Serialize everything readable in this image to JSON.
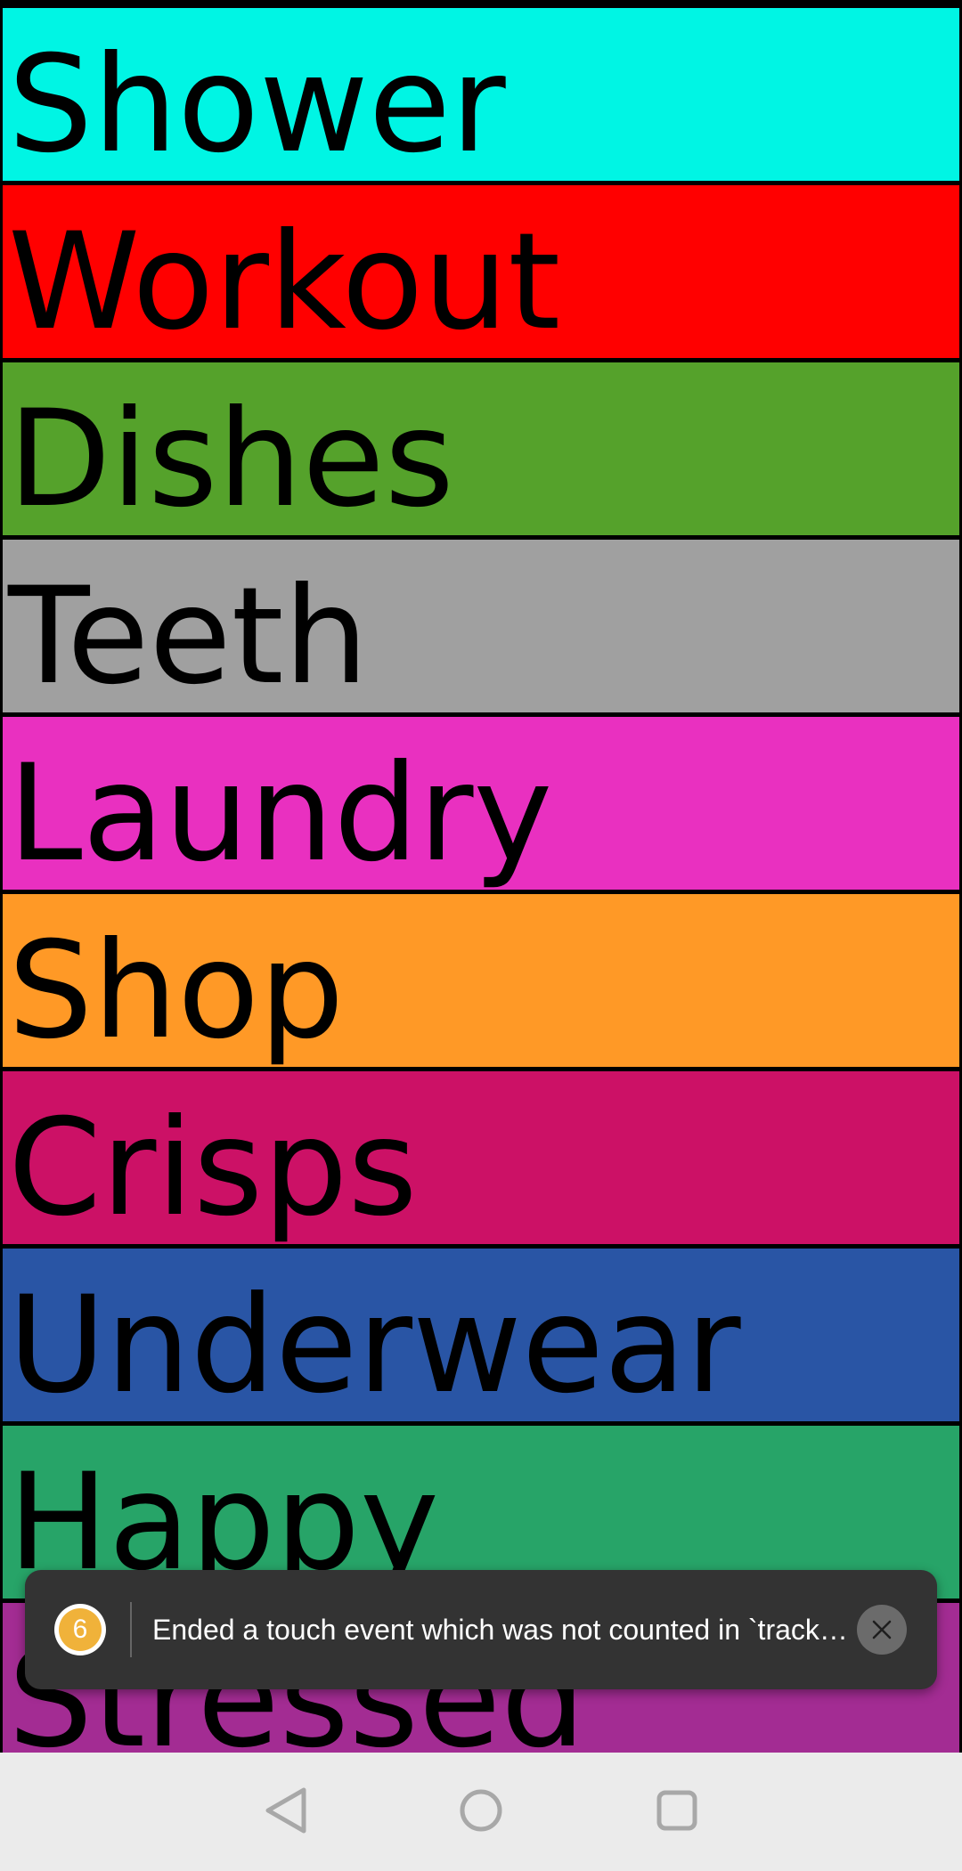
{
  "rows": [
    {
      "label": "Shower",
      "color": "#00F5E4"
    },
    {
      "label": "Workout",
      "color": "#FF0000"
    },
    {
      "label": "Dishes",
      "color": "#55A22B"
    },
    {
      "label": "Teeth",
      "color": "#A0A0A0"
    },
    {
      "label": "Laundry",
      "color": "#E930C0"
    },
    {
      "label": "Shop",
      "color": "#FF9926"
    },
    {
      "label": "Crisps",
      "color": "#CC1166"
    },
    {
      "label": "Underwear",
      "color": "#2955A5"
    },
    {
      "label": "Happy",
      "color": "#27A468"
    },
    {
      "label": "Stressed",
      "color": "#A32C93"
    }
  ],
  "toast": {
    "badge_count": "6",
    "message": "Ended a touch event which was not counted in `trackedTouchCount`.",
    "background": "#333333",
    "badge_color": "#F0B23A"
  },
  "nav_bar": {
    "back_icon": "back-triangle-icon",
    "home_icon": "home-circle-icon",
    "recents_icon": "recents-square-icon",
    "background": "#EBEBEB"
  }
}
